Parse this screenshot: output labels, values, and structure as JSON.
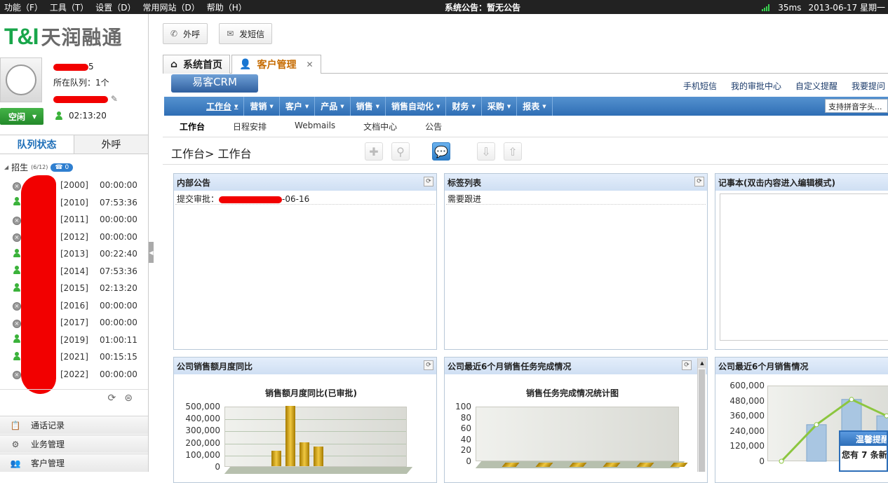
{
  "topbar": {
    "menu": [
      "功能（F）",
      "工具（T）",
      "设置（D）",
      "常用网站（D）",
      "帮助（H）"
    ],
    "notice": "系统公告：暂无公告",
    "ping": "35ms",
    "date": "2013-06-17 星期一"
  },
  "brand": {
    "logo_mark": "T&I",
    "logo_text": "天润融通"
  },
  "user": {
    "id_suffix": "5",
    "queue_label": "所在队列：1个",
    "status": "空闲",
    "timer": "02:13:20"
  },
  "left_tabs": {
    "queue": "队列状态",
    "outbound": "外呼"
  },
  "group": {
    "name": "招生",
    "count": "(6/12)",
    "waiting": "0"
  },
  "agents": [
    {
      "state": "offline",
      "code": "[2000]",
      "time": "00:00:00"
    },
    {
      "state": "online",
      "code": "[2010]",
      "time": "07:53:36"
    },
    {
      "state": "offline",
      "code": "[2011]",
      "time": "00:00:00"
    },
    {
      "state": "offline",
      "code": "[2012]",
      "time": "00:00:00"
    },
    {
      "state": "online",
      "code": "[2013]",
      "time": "00:22:40"
    },
    {
      "state": "online",
      "code": "[2014]",
      "time": "07:53:36"
    },
    {
      "state": "online",
      "code": "[2015]",
      "time": "02:13:20"
    },
    {
      "state": "offline",
      "code": "[2016]",
      "time": "00:00:00"
    },
    {
      "state": "offline",
      "code": "[2017]",
      "time": "00:00:00"
    },
    {
      "state": "online",
      "code": "[2019]",
      "time": "01:00:11"
    },
    {
      "state": "online",
      "code": "[2021]",
      "time": "00:15:15"
    },
    {
      "state": "offline",
      "code": "[2022]",
      "time": "00:00:00"
    }
  ],
  "left_nav": [
    "通话记录",
    "业务管理",
    "客户管理"
  ],
  "toolbar": {
    "call": "外呼",
    "sms": "发短信"
  },
  "main_tabs": {
    "home": "系统首页",
    "crm": "客户管理"
  },
  "crm": {
    "logo": "易客CRM",
    "links": [
      "手机短信",
      "我的审批中心",
      "自定义提醒",
      "我要提问"
    ],
    "nav": [
      "工作台",
      "营销",
      "客户",
      "产品",
      "销售",
      "销售自动化",
      "财务",
      "采购",
      "报表"
    ],
    "search": "支持拼音字头...",
    "subnav": [
      "工作台",
      "日程安排",
      "Webmails",
      "文档中心",
      "公告"
    ],
    "breadcrumb": "工作台> 工作台"
  },
  "panels": {
    "notice": {
      "title": "内部公告",
      "row_prefix": "提交审批：",
      "row_suffix": "-06-16"
    },
    "tags": {
      "title": "标签列表",
      "row": "需要跟进"
    },
    "memo": {
      "title": "记事本(双击内容进入编辑模式)"
    },
    "sales_yoy": {
      "title": "公司销售额月度同比",
      "chart_title": "销售额月度同比(已审批)"
    },
    "task": {
      "title": "公司最近6个月销售任务完成情况",
      "chart_title": "销售任务完成情况统计图"
    },
    "recent": {
      "title": "公司最近6个月销售情况"
    }
  },
  "chart_data": [
    {
      "type": "bar",
      "title": "销售额月度同比(已审批)",
      "ylim": [
        0,
        500000
      ],
      "yticks": [
        "500,000",
        "400,000",
        "300,000",
        "200,000",
        "100,000",
        "0"
      ],
      "values": [
        130000,
        500000,
        200000,
        160000
      ]
    },
    {
      "type": "bar",
      "title": "销售任务完成情况统计图",
      "ylim": [
        0,
        100
      ],
      "yticks": [
        "100",
        "80",
        "60",
        "40",
        "20",
        "0"
      ],
      "values": [
        0,
        0,
        0,
        0,
        0,
        0
      ]
    },
    {
      "type": "line",
      "yticks": [
        "600,000",
        "480,000",
        "360,000",
        "240,000",
        "120,000",
        "0"
      ],
      "ylim": [
        0,
        600000
      ],
      "values": [
        0,
        290000,
        490000,
        360000
      ]
    }
  ],
  "toast": {
    "title": "温馨提醒",
    "body": "您有 7 条新"
  },
  "colors": {
    "accent": "#2f6eb5",
    "green": "#19a64b",
    "redact": "#f20000"
  }
}
